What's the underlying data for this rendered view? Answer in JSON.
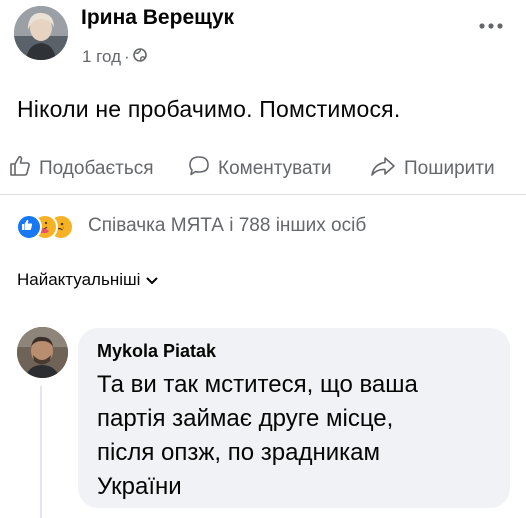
{
  "post": {
    "author": "Ірина Верещук",
    "time": "1 год",
    "separator": "·",
    "privacy_icon": "globe-icon",
    "more_icon": "more-dots-icon",
    "text": "Ніколи не пробачимо. Помстимося."
  },
  "actions": {
    "like": "Подобається",
    "comment": "Коментувати",
    "share": "Поширити"
  },
  "reactions": {
    "icons": [
      "like-reaction-icon",
      "care-reaction-icon",
      "sad-reaction-icon"
    ],
    "summary": "Співачка МЯТА і 788 інших осіб"
  },
  "comments": {
    "sort_label": "Найактуальніші",
    "items": [
      {
        "author": "Mykola Piatak",
        "lines": [
          "Та ви так мститеся, що ваша",
          "партія займає друге місце,",
          "після опзж, по зрадникам",
          "України"
        ]
      }
    ]
  },
  "colors": {
    "text": "#050505",
    "secondary": "#65676b",
    "like_blue": "#1877f2",
    "bubble": "#f0f2f5"
  }
}
